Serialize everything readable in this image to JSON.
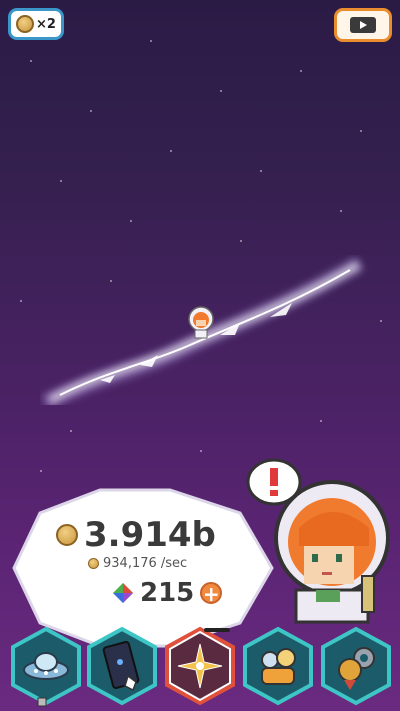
{
  "top_bar": {
    "multiplier_label": "×2",
    "left_button_icon": "coin-boost-icon",
    "right_button_icon": "play-video-icon"
  },
  "stats": {
    "gold_amount": "3.914b",
    "gold_rate": "934,176 /sec",
    "gem_amount": "215",
    "gold_icon": "coin-icon",
    "gem_icon": "rainbow-gem-icon",
    "add_gem_icon": "plus-icon"
  },
  "character": {
    "alert_icon": "exclamation-icon"
  },
  "nav": {
    "items": [
      {
        "name": "ufo",
        "icon": "ufo-icon"
      },
      {
        "name": "phone",
        "icon": "phone-tap-icon"
      },
      {
        "name": "galaxy",
        "icon": "compass-star-icon",
        "active": true
      },
      {
        "name": "characters",
        "icon": "characters-icon"
      },
      {
        "name": "settings",
        "icon": "medal-gear-icon"
      }
    ]
  },
  "colors": {
    "nav_border": "#3ec6c6",
    "active_border": "#e0503a",
    "background_top": "#2a1b45",
    "background_bottom": "#6a2a80"
  }
}
